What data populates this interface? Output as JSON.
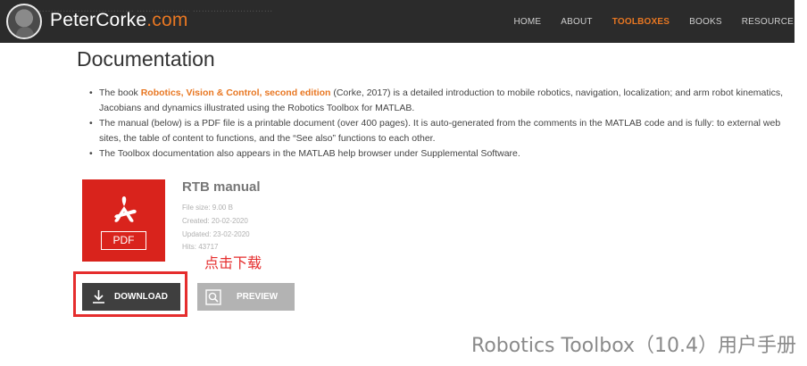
{
  "header": {
    "ghost_text": "…………………………… ……………… ………………………",
    "brand_name": "PeterCorke",
    "brand_tld": ".com",
    "nav": [
      {
        "label": "HOME",
        "active": false
      },
      {
        "label": "ABOUT",
        "active": false
      },
      {
        "label": "TOOLBOXES",
        "active": true
      },
      {
        "label": "BOOKS",
        "active": false
      },
      {
        "label": "RESOURCE",
        "active": false
      }
    ]
  },
  "main": {
    "title": "Documentation",
    "bullets": {
      "b1_pre": "The book ",
      "b1_link": "Robotics, Vision & Control, second edition",
      "b1_post": " (Corke, 2017)  is a detailed introduction to mobile robotics, navigation, localization; and arm robot kinematics, Jacobians and dynamics illustrated using the Robotics Toolbox for MATLAB.",
      "b2": "The manual (below) is a PDF file is a printable document (over 400 pages).  It is auto-generated from the comments in the MATLAB code and is fully: to external web sites, the table of content to functions, and the “See also” functions to each other.",
      "b3": "The Toolbox documentation also appears in the MATLAB help browser under Supplemental Software."
    }
  },
  "file": {
    "icon_label": "PDF",
    "title": "RTB manual",
    "size": "File size: 9.00 B",
    "created": "Created: 20-02-2020",
    "updated": "Updated: 23-02-2020",
    "hits": "Hits: 43717"
  },
  "buttons": {
    "download": "DOWNLOAD",
    "preview": "PREVIEW"
  },
  "annotation": {
    "text": "点击下载",
    "color": "#e52d2d"
  },
  "caption": "Robotics Toolbox（10.4）用户手册",
  "colors": {
    "accent": "#e87722",
    "pdf_red": "#d9231c",
    "header_bg": "#2b2b2b"
  }
}
